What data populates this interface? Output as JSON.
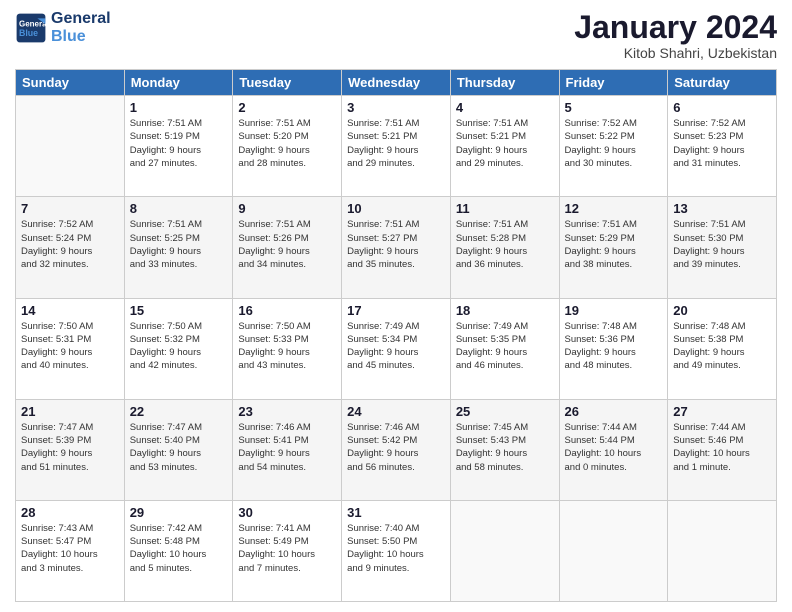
{
  "header": {
    "logo_line1": "General",
    "logo_line2": "Blue",
    "month": "January 2024",
    "location": "Kitob Shahri, Uzbekistan"
  },
  "columns": [
    "Sunday",
    "Monday",
    "Tuesday",
    "Wednesday",
    "Thursday",
    "Friday",
    "Saturday"
  ],
  "weeks": [
    {
      "rowClass": "row-white",
      "days": [
        {
          "number": "",
          "info": ""
        },
        {
          "number": "1",
          "info": "Sunrise: 7:51 AM\nSunset: 5:19 PM\nDaylight: 9 hours\nand 27 minutes."
        },
        {
          "number": "2",
          "info": "Sunrise: 7:51 AM\nSunset: 5:20 PM\nDaylight: 9 hours\nand 28 minutes."
        },
        {
          "number": "3",
          "info": "Sunrise: 7:51 AM\nSunset: 5:21 PM\nDaylight: 9 hours\nand 29 minutes."
        },
        {
          "number": "4",
          "info": "Sunrise: 7:51 AM\nSunset: 5:21 PM\nDaylight: 9 hours\nand 29 minutes."
        },
        {
          "number": "5",
          "info": "Sunrise: 7:52 AM\nSunset: 5:22 PM\nDaylight: 9 hours\nand 30 minutes."
        },
        {
          "number": "6",
          "info": "Sunrise: 7:52 AM\nSunset: 5:23 PM\nDaylight: 9 hours\nand 31 minutes."
        }
      ]
    },
    {
      "rowClass": "row-alt",
      "days": [
        {
          "number": "7",
          "info": "Sunrise: 7:52 AM\nSunset: 5:24 PM\nDaylight: 9 hours\nand 32 minutes."
        },
        {
          "number": "8",
          "info": "Sunrise: 7:51 AM\nSunset: 5:25 PM\nDaylight: 9 hours\nand 33 minutes."
        },
        {
          "number": "9",
          "info": "Sunrise: 7:51 AM\nSunset: 5:26 PM\nDaylight: 9 hours\nand 34 minutes."
        },
        {
          "number": "10",
          "info": "Sunrise: 7:51 AM\nSunset: 5:27 PM\nDaylight: 9 hours\nand 35 minutes."
        },
        {
          "number": "11",
          "info": "Sunrise: 7:51 AM\nSunset: 5:28 PM\nDaylight: 9 hours\nand 36 minutes."
        },
        {
          "number": "12",
          "info": "Sunrise: 7:51 AM\nSunset: 5:29 PM\nDaylight: 9 hours\nand 38 minutes."
        },
        {
          "number": "13",
          "info": "Sunrise: 7:51 AM\nSunset: 5:30 PM\nDaylight: 9 hours\nand 39 minutes."
        }
      ]
    },
    {
      "rowClass": "row-white",
      "days": [
        {
          "number": "14",
          "info": "Sunrise: 7:50 AM\nSunset: 5:31 PM\nDaylight: 9 hours\nand 40 minutes."
        },
        {
          "number": "15",
          "info": "Sunrise: 7:50 AM\nSunset: 5:32 PM\nDaylight: 9 hours\nand 42 minutes."
        },
        {
          "number": "16",
          "info": "Sunrise: 7:50 AM\nSunset: 5:33 PM\nDaylight: 9 hours\nand 43 minutes."
        },
        {
          "number": "17",
          "info": "Sunrise: 7:49 AM\nSunset: 5:34 PM\nDaylight: 9 hours\nand 45 minutes."
        },
        {
          "number": "18",
          "info": "Sunrise: 7:49 AM\nSunset: 5:35 PM\nDaylight: 9 hours\nand 46 minutes."
        },
        {
          "number": "19",
          "info": "Sunrise: 7:48 AM\nSunset: 5:36 PM\nDaylight: 9 hours\nand 48 minutes."
        },
        {
          "number": "20",
          "info": "Sunrise: 7:48 AM\nSunset: 5:38 PM\nDaylight: 9 hours\nand 49 minutes."
        }
      ]
    },
    {
      "rowClass": "row-alt",
      "days": [
        {
          "number": "21",
          "info": "Sunrise: 7:47 AM\nSunset: 5:39 PM\nDaylight: 9 hours\nand 51 minutes."
        },
        {
          "number": "22",
          "info": "Sunrise: 7:47 AM\nSunset: 5:40 PM\nDaylight: 9 hours\nand 53 minutes."
        },
        {
          "number": "23",
          "info": "Sunrise: 7:46 AM\nSunset: 5:41 PM\nDaylight: 9 hours\nand 54 minutes."
        },
        {
          "number": "24",
          "info": "Sunrise: 7:46 AM\nSunset: 5:42 PM\nDaylight: 9 hours\nand 56 minutes."
        },
        {
          "number": "25",
          "info": "Sunrise: 7:45 AM\nSunset: 5:43 PM\nDaylight: 9 hours\nand 58 minutes."
        },
        {
          "number": "26",
          "info": "Sunrise: 7:44 AM\nSunset: 5:44 PM\nDaylight: 10 hours\nand 0 minutes."
        },
        {
          "number": "27",
          "info": "Sunrise: 7:44 AM\nSunset: 5:46 PM\nDaylight: 10 hours\nand 1 minute."
        }
      ]
    },
    {
      "rowClass": "row-white",
      "days": [
        {
          "number": "28",
          "info": "Sunrise: 7:43 AM\nSunset: 5:47 PM\nDaylight: 10 hours\nand 3 minutes."
        },
        {
          "number": "29",
          "info": "Sunrise: 7:42 AM\nSunset: 5:48 PM\nDaylight: 10 hours\nand 5 minutes."
        },
        {
          "number": "30",
          "info": "Sunrise: 7:41 AM\nSunset: 5:49 PM\nDaylight: 10 hours\nand 7 minutes."
        },
        {
          "number": "31",
          "info": "Sunrise: 7:40 AM\nSunset: 5:50 PM\nDaylight: 10 hours\nand 9 minutes."
        },
        {
          "number": "",
          "info": ""
        },
        {
          "number": "",
          "info": ""
        },
        {
          "number": "",
          "info": ""
        }
      ]
    }
  ]
}
